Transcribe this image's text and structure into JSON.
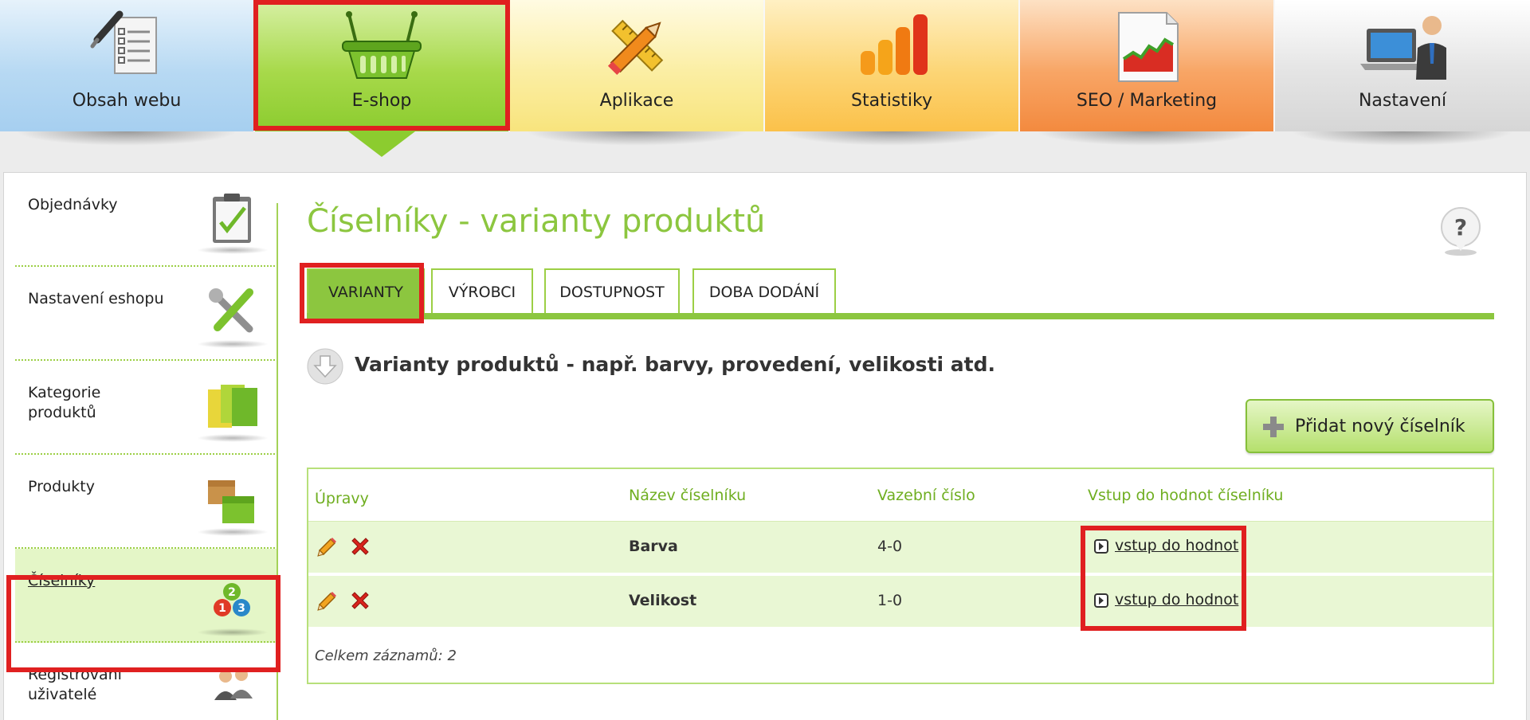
{
  "topnav": {
    "items": [
      {
        "label": "Obsah webu",
        "icon": "document-pen-icon"
      },
      {
        "label": "E-shop",
        "icon": "basket-icon"
      },
      {
        "label": "Aplikace",
        "icon": "pencil-ruler-icon"
      },
      {
        "label": "Statistiky",
        "icon": "bar-chart-icon"
      },
      {
        "label": "SEO / Marketing",
        "icon": "area-chart-document-icon"
      },
      {
        "label": "Nastavení",
        "icon": "laptop-user-icon"
      }
    ],
    "active": "E-shop"
  },
  "sidebar": {
    "items": [
      {
        "label": "Objednávky",
        "icon": "clipboard-icon"
      },
      {
        "label": "Nastavení eshopu",
        "icon": "tools-icon"
      },
      {
        "label": "Kategorie produktů",
        "icon": "folders-icon"
      },
      {
        "label": "Produkty",
        "icon": "boxes-icon"
      },
      {
        "label": "Číselníky",
        "icon": "numbers-icon"
      },
      {
        "label": "Registrovaní uživatelé",
        "icon": "users-icon"
      }
    ],
    "active": "Číselníky"
  },
  "main": {
    "title": "Číselníky - varianty produktů",
    "tabs": [
      {
        "label": "VARIANTY"
      },
      {
        "label": "VÝROBCI"
      },
      {
        "label": "DOSTUPNOST"
      },
      {
        "label": "DOBA DODÁNÍ"
      }
    ],
    "active_tab": "VARIANTY",
    "section_title": "Varianty produktů - např. barvy, provedení, velikosti atd.",
    "add_button": "Přidat nový číselník",
    "table": {
      "headers": [
        "Úpravy",
        "Název číselníku",
        "Vazební číslo",
        "Vstup do hodnot číselníku"
      ],
      "rows": [
        {
          "name": "Barva",
          "code": "4-0",
          "link": "vstup do hodnot"
        },
        {
          "name": "Velikost",
          "code": "1-0",
          "link": "vstup do hodnot"
        }
      ],
      "footer": "Celkem záznamů: 2"
    }
  },
  "colors": {
    "accent_green": "#8cc63f",
    "highlight_red": "#e02020"
  }
}
